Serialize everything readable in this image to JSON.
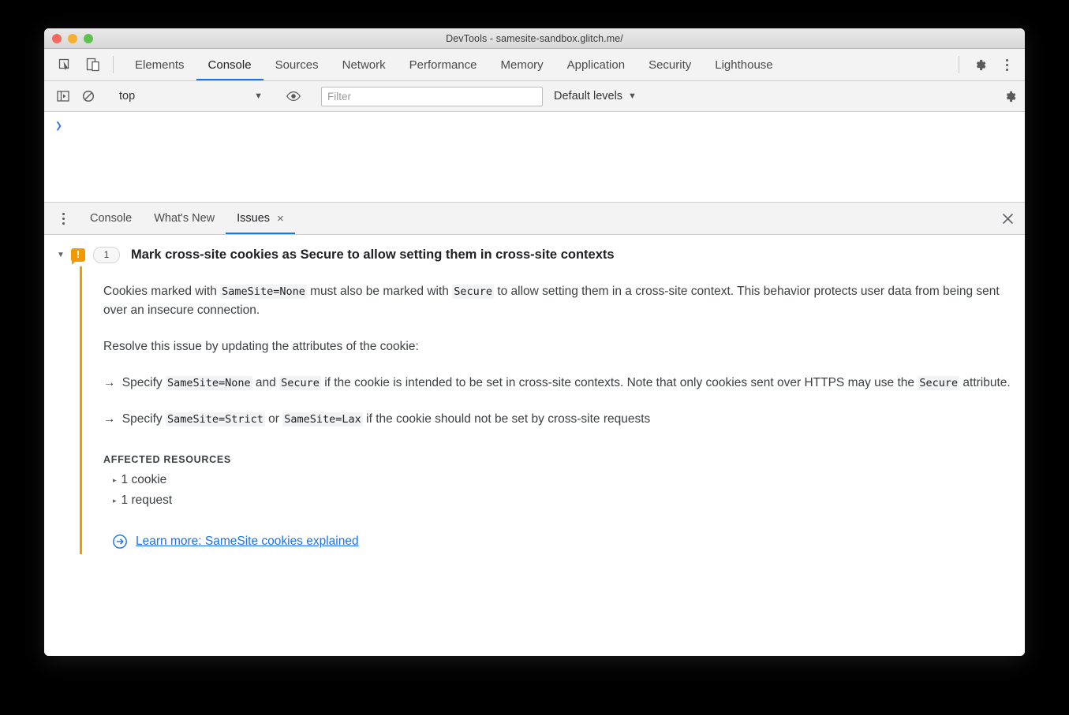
{
  "window": {
    "title": "DevTools - samesite-sandbox.glitch.me/"
  },
  "toolbar": {
    "inspect_icon": "inspect-cursor-icon",
    "device_icon": "device-toolbar-icon",
    "tabs": [
      {
        "label": "Elements",
        "active": false
      },
      {
        "label": "Console",
        "active": true
      },
      {
        "label": "Sources",
        "active": false
      },
      {
        "label": "Network",
        "active": false
      },
      {
        "label": "Performance",
        "active": false
      },
      {
        "label": "Memory",
        "active": false
      },
      {
        "label": "Application",
        "active": false
      },
      {
        "label": "Security",
        "active": false
      },
      {
        "label": "Lighthouse",
        "active": false
      }
    ],
    "settings_icon": "gear-icon",
    "more_icon": "kebab-menu-icon"
  },
  "console_toolbar": {
    "sidebar_toggle_icon": "console-sidebar-icon",
    "clear_icon": "clear-console-icon",
    "context_value": "top",
    "context_caret": "▼",
    "live_expression_icon": "eye-icon",
    "filter_placeholder": "Filter",
    "filter_value": "",
    "levels_label": "Default levels",
    "levels_caret": "▼",
    "console_settings_icon": "gear-icon"
  },
  "console_output": {
    "prompt": "❯"
  },
  "drawer": {
    "more_icon": "kebab-menu-icon",
    "tabs": [
      {
        "label": "Console",
        "active": false,
        "closeable": false
      },
      {
        "label": "What's New",
        "active": false,
        "closeable": false
      },
      {
        "label": "Issues",
        "active": true,
        "closeable": true,
        "close_glyph": "×"
      }
    ],
    "close_glyph": "✕"
  },
  "issue": {
    "disclosure_glyph": "▼",
    "severity_glyph": "!",
    "severity_color": "#f29900",
    "count": "1",
    "title": "Mark cross-site cookies as Secure to allow setting them in cross-site contexts",
    "paragraph1": {
      "part1": "Cookies marked with ",
      "code1": "SameSite=None",
      "part2": " must also be marked with ",
      "code2": "Secure",
      "part3": " to allow setting them in a cross-site context. This behavior protects user data from being sent over an insecure connection."
    },
    "paragraph2": "Resolve this issue by updating the attributes of the cookie:",
    "bullet1": {
      "arrow": "→",
      "part1": " Specify ",
      "code1": "SameSite=None",
      "part2": " and ",
      "code2": "Secure",
      "part3": " if the cookie is intended to be set in cross-site contexts. Note that only cookies sent over HTTPS may use the ",
      "code3": "Secure",
      "part4": " attribute."
    },
    "bullet2": {
      "arrow": "→",
      "part1": " Specify ",
      "code1": "SameSite=Strict",
      "part2": " or ",
      "code2": "SameSite=Lax",
      "part3": " if the cookie should not be set by cross-site requests"
    },
    "affected_label": "AFFECTED RESOURCES",
    "resources": [
      {
        "triangle": "▸",
        "label": "1 cookie"
      },
      {
        "triangle": "▸",
        "label": "1 request"
      }
    ],
    "learn_more": {
      "icon": "external-link-circle-arrow-icon",
      "label": "Learn more: SameSite cookies explained",
      "color": "#1a73e8"
    }
  }
}
